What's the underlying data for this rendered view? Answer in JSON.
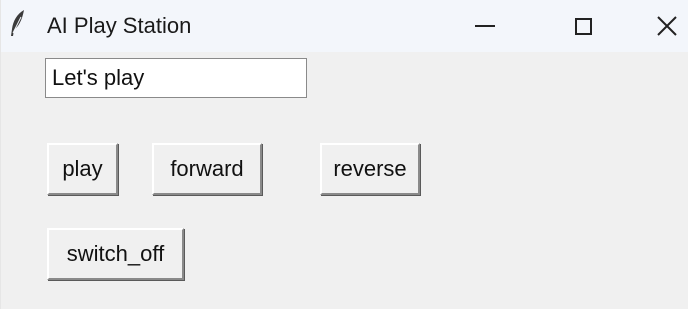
{
  "window": {
    "title": "AI Play Station",
    "app_icon": "feather-icon",
    "controls": {
      "minimize_icon": "minimize-icon",
      "maximize_icon": "maximize-icon",
      "close_icon": "close-icon"
    }
  },
  "entry": {
    "value": "Let's play"
  },
  "buttons": {
    "play": "play",
    "forward": "forward",
    "reverse": "reverse",
    "switch_off": "switch_off"
  },
  "colors": {
    "window_background": "#f0f0f0",
    "titlebar_background": "#f3f6fb",
    "entry_background": "#ffffff"
  }
}
